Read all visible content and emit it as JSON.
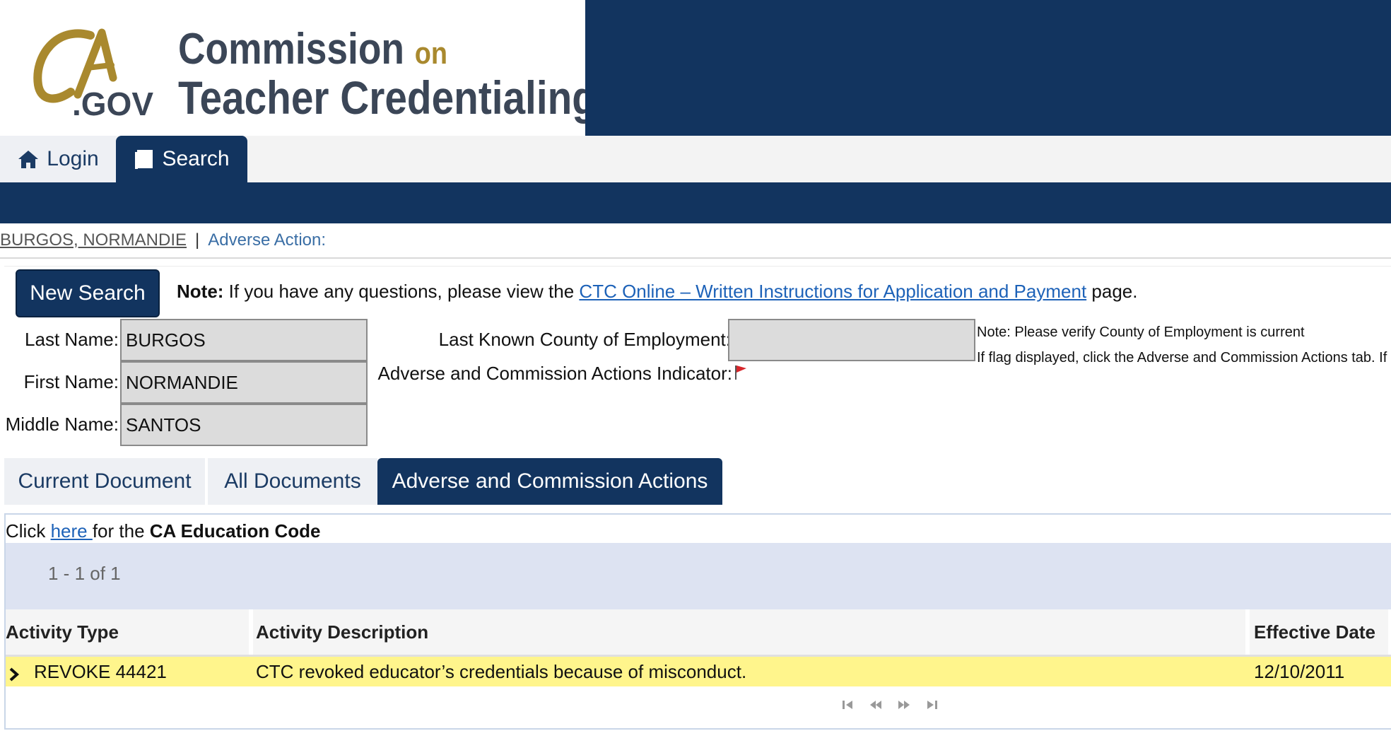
{
  "header": {
    "logo": {
      "mark": "CA",
      "suffix": ".GOV"
    },
    "title_line1": "Commission",
    "title_on": "on",
    "title_line2": "Teacher Credentialing",
    "colors": {
      "navy": "#12345f",
      "gold": "#a9892e",
      "slate": "#3b4657"
    }
  },
  "nav": {
    "login": {
      "label": "Login",
      "icon": "home-icon"
    },
    "search": {
      "label": "Search",
      "icon": "document-icon"
    }
  },
  "breadcrumb": {
    "name": "BURGOS, NORMANDIE",
    "separator": "|",
    "current": "Adverse Action:"
  },
  "panel": {
    "new_search_label": "New Search",
    "note_bold": "Note:",
    "note_text": " If you have any questions, please view the ",
    "note_link": "CTC Online – Written Instructions for Application and Payment",
    "note_tail": " page.",
    "last_name_label": "Last Name:",
    "last_name_value": "BURGOS",
    "first_name_label": "First Name:",
    "first_name_value": "NORMANDIE",
    "middle_name_label": "Middle Name:",
    "middle_name_value": "SANTOS",
    "county_label": "Last Known County of Employment:",
    "county_value": "",
    "indicator_label": "Adverse and Commission Actions Indicator:",
    "indicator_icon": "red-flag-icon",
    "county_note": "Note: Please verify County of Employment is current",
    "flag_note": "If flag displayed, click the Adverse and Commission Actions tab. If"
  },
  "tabs": [
    {
      "label": "Current Document",
      "active": false
    },
    {
      "label": "All Documents",
      "active": false
    },
    {
      "label": "Adverse and Commission Actions",
      "active": true
    }
  ],
  "results": {
    "click_prefix": "Click ",
    "click_link": "here ",
    "click_middle": "for the ",
    "click_bold": "CA Education Code",
    "pager_count": "1 - 1 of 1",
    "columns": [
      "Activity Type",
      "Activity Description",
      "Effective Date"
    ],
    "rows": [
      {
        "type": "REVOKE 44421",
        "description": "CTC revoked educator’s credentials because of misconduct.",
        "date": "12/10/2011"
      }
    ],
    "pager_icons": [
      "first-page-icon",
      "prev-page-icon",
      "next-page-icon",
      "last-page-icon"
    ]
  }
}
